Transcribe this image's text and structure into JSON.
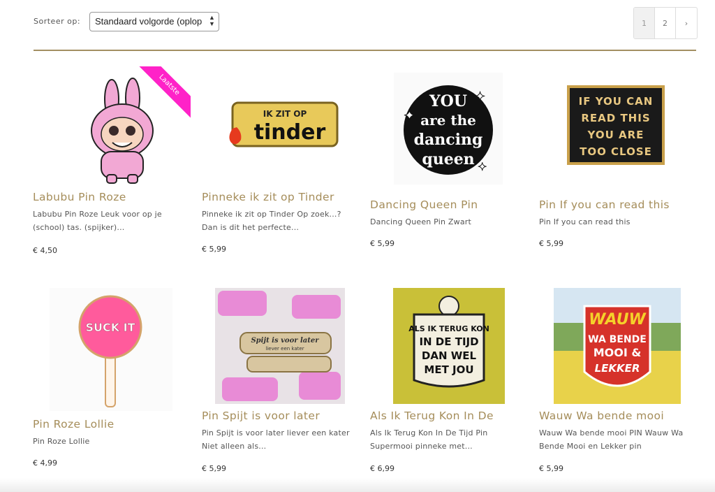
{
  "toolbar": {
    "sort_label": "Sorteer op:",
    "sort_value": "Standaard volgorde (oplop",
    "pagination": [
      "1",
      "2",
      "›"
    ]
  },
  "products": [
    {
      "title": "Labubu Pin Roze",
      "desc": "Labubu Pin Roze Leuk voor op je (school) tas. (spijker)...",
      "price": "€ 4,50",
      "ribbon": "Laatste"
    },
    {
      "title": "Pinneke ik zit op Tinder",
      "desc": "Pinneke ik zit op Tinder Op zoek...? Dan is dit het perfecte...",
      "price": "€ 5,99",
      "art": [
        "IK ZIT OP",
        "tinder"
      ]
    },
    {
      "title": "Dancing Queen Pin",
      "desc": "Dancing Queen Pin Zwart",
      "price": "€ 5,99",
      "art": [
        "YOU",
        "are the",
        "dancing",
        "queen"
      ]
    },
    {
      "title": "Pin If you can read this",
      "desc": "Pin If you can read this",
      "price": "€ 5,99",
      "art": [
        "IF YOU CAN",
        "READ THIS",
        "YOU ARE",
        "TOO CLOSE"
      ]
    },
    {
      "title": "Pin Roze Lollie",
      "desc": "Pin Roze Lollie",
      "price": "€ 4,99",
      "art": [
        "SUCK IT"
      ]
    },
    {
      "title": "Pin Spijt is voor later",
      "desc": "Pin Spijt is voor later liever een kater Niet alleen als...",
      "price": "€ 5,99",
      "art": [
        "Spijt is voor later",
        "liever een kater"
      ]
    },
    {
      "title": "Als Ik Terug Kon In De",
      "desc": "Als Ik Terug Kon In De Tijd Pin Supermooi pinneke met...",
      "price": "€ 6,99",
      "art": [
        "ALS IK TERUG KON",
        "IN DE TIJD",
        "DAN WEL",
        "MET JOU"
      ]
    },
    {
      "title": "Wauw Wa bende mooi",
      "desc": "Wauw Wa bende mooi PIN Wauw Wa Bende Mooi en Lekker pin",
      "price": "€ 5,99",
      "art": [
        "WAUW",
        "WA BENDE",
        "MOOI &",
        "LEKKER"
      ]
    }
  ]
}
